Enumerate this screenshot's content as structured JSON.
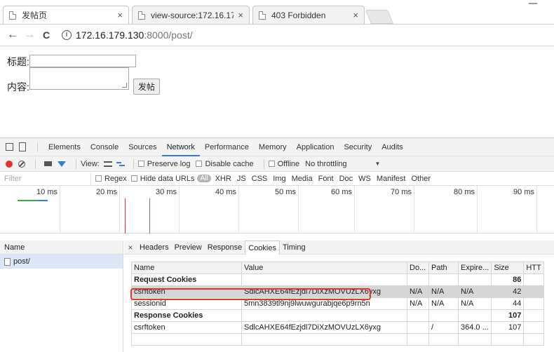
{
  "browser": {
    "tabs": [
      {
        "title": "发帖页",
        "close": "×",
        "active": true
      },
      {
        "title": "view-source:172.16.17",
        "close": "×",
        "active": false
      },
      {
        "title": "403 Forbidden",
        "close": "×",
        "active": false
      }
    ],
    "nav": {
      "back": "←",
      "forward": "→",
      "reload": "C"
    },
    "url": {
      "host": "172.16.179.130",
      "rest": ":8000/post/"
    }
  },
  "page": {
    "title_label": "标题:",
    "content_label": "内容:",
    "submit_label": "发帖"
  },
  "devtools": {
    "tabs": [
      "Elements",
      "Console",
      "Sources",
      "Network",
      "Performance",
      "Memory",
      "Application",
      "Security",
      "Audits"
    ],
    "selected_tab": "Network",
    "toolbar": {
      "view_label": "View:",
      "preserve_log": "Preserve log",
      "disable_cache": "Disable cache",
      "offline": "Offline",
      "throttling": "No throttling"
    },
    "filter": {
      "placeholder": "Filter",
      "regex": "Regex",
      "hide_data_urls": "Hide data URLs",
      "all": "All",
      "types": [
        "XHR",
        "JS",
        "CSS",
        "Img",
        "Media",
        "Font",
        "Doc",
        "WS",
        "Manifest",
        "Other"
      ]
    },
    "timeline_ticks": [
      "10 ms",
      "20 ms",
      "30 ms",
      "40 ms",
      "50 ms",
      "60 ms",
      "70 ms",
      "80 ms",
      "90 ms"
    ],
    "requests": {
      "header": "Name",
      "items": [
        "post/"
      ]
    },
    "detail": {
      "close": "×",
      "tabs": [
        "Headers",
        "Preview",
        "Response",
        "Cookies",
        "Timing"
      ],
      "selected_tab": "Cookies",
      "columns": [
        "Name",
        "Value",
        "Do...",
        "Path",
        "Expire...",
        "Size",
        "HTT"
      ],
      "rows": [
        {
          "type": "group",
          "name": "Request Cookies",
          "size": "86"
        },
        {
          "type": "cookie",
          "name": "csrftoken",
          "value": "SdlcAHXE64fEzjdl7DiXzMOVUzLX6yxg",
          "domain": "N/A",
          "path": "N/A",
          "expires": "N/A",
          "size": "42",
          "highlight": true
        },
        {
          "type": "cookie",
          "name": "sessionid",
          "value": "5mn3839tl9nj9lwuwgurabjqe6p9rn5n",
          "domain": "N/A",
          "path": "N/A",
          "expires": "N/A",
          "size": "44"
        },
        {
          "type": "group",
          "name": "Response Cookies",
          "size": "107"
        },
        {
          "type": "cookie",
          "name": "csrftoken",
          "value": "SdlcAHXE64fEzjdl7DiXzMOVUzLX6yxg",
          "domain": "",
          "path": "/",
          "expires": "364.0 ...",
          "size": "107"
        }
      ]
    }
  },
  "colors": {
    "record": "#e8312e",
    "accent_blue": "#3879d9",
    "highlight_border": "#e0382f"
  }
}
